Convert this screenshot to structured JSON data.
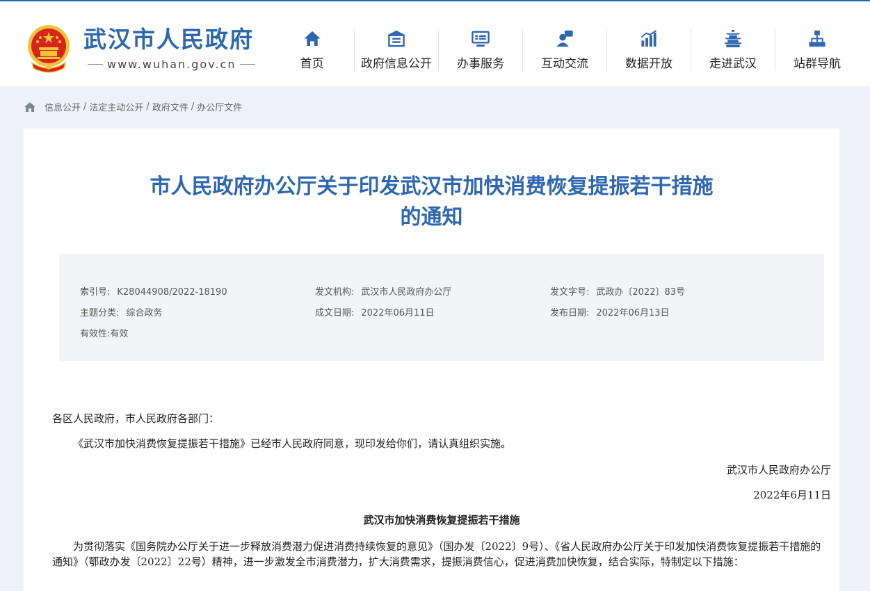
{
  "site": {
    "name": "武汉市人民政府",
    "url": "www.wuhan.gov.cn"
  },
  "nav": [
    {
      "label": "首页",
      "icon": "home-icon"
    },
    {
      "label": "政府信息公开",
      "icon": "building-icon"
    },
    {
      "label": "办事服务",
      "icon": "monitor-icon"
    },
    {
      "label": "互动交流",
      "icon": "chat-user-icon"
    },
    {
      "label": "数据开放",
      "icon": "bar-chart-icon"
    },
    {
      "label": "走进武汉",
      "icon": "tower-icon"
    },
    {
      "label": "站群导航",
      "icon": "sitemap-icon"
    }
  ],
  "breadcrumb": [
    "信息公开",
    "法定主动公开",
    "政府文件",
    "办公厅文件"
  ],
  "document": {
    "title_line1": "市人民政府办公厅关于印发武汉市加快消费恢复提振若干措施",
    "title_line2": "的通知"
  },
  "meta": {
    "index_label": "索引号:",
    "index_value": "K28044908/2022-18190",
    "issuer_label": "发文机构:",
    "issuer_value": "武汉市人民政府办公厅",
    "docno_label": "发文字号:",
    "docno_value": "武政办〔2022〕83号",
    "topic_label": "主题分类:",
    "topic_value": "综合政务",
    "created_label": "成文日期:",
    "created_value": "2022年06月11日",
    "published_label": "发布日期:",
    "published_value": "2022年06月13日",
    "validity_label": "有效性:",
    "validity_value": "有效"
  },
  "body": {
    "salutation": "各区人民政府，市人民政府各部门：",
    "para1": "《武汉市加快消费恢复提振若干措施》已经市人民政府同意，现印发给你们，请认真组织实施。",
    "signature": "武汉市人民政府办公厅",
    "date": "2022年6月11日",
    "subtitle": "武汉市加快消费恢复提振若干措施",
    "para2": "为贯彻落实《国务院办公厅关于进一步释放消费潜力促进消费持续恢复的意见》（国办发〔2022〕9号）、《省人民政府办公厅关于印发加快消费恢复提振若干措施的通知》（鄂政办发〔2022〕22号）精神，进一步激发全市消费潜力，扩大消费需求，提振消费信心，促进消费加快恢复，结合实际，特制定以下措施："
  },
  "colors": {
    "brand_blue": "#2e67b1",
    "emblem_red": "#d7251d",
    "emblem_gold": "#f3c23c"
  }
}
